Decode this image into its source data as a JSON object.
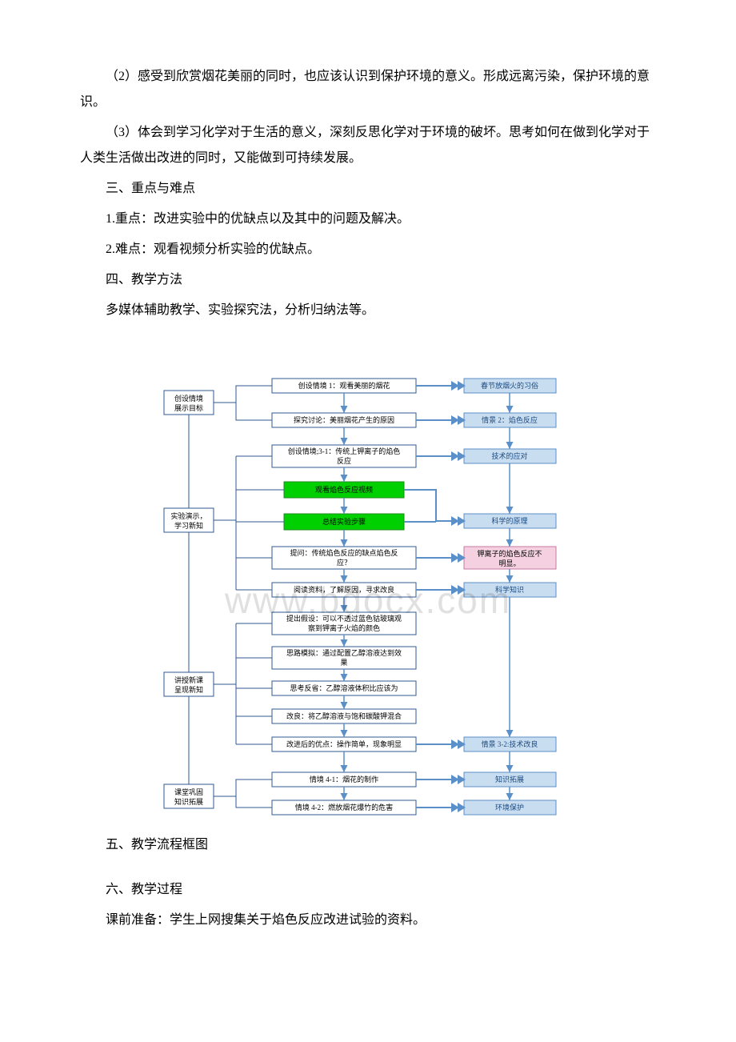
{
  "paragraphs": {
    "p1": "（2）感受到欣赏烟花美丽的同时，也应该认识到保护环境的意义。形成远离污染，保护环境的意识。",
    "p2": "（3）体会到学习化学对于生活的意义，深刻反思化学对于环境的破坏。思考如何在做到化学对于人类生活做出改进的同时，又能做到可持续发展。",
    "h3": "三、重点与难点",
    "p3": "1.重点：改进实验中的优缺点以及其中的问题及解决。",
    "p4": "2.难点：观看视频分析实验的优缺点。",
    "h4": "四、教学方法",
    "p5": "多媒体辅助教学、实验探究法，分析归纳法等。",
    "h5": "五、教学流程框图",
    "h6": "六、教学过程",
    "p6": "课前准备：学生上网搜集关于焰色反应改进试验的资料。"
  },
  "flow": {
    "left": {
      "l1a": "创设情境",
      "l1b": "展示目标",
      "l2a": "实验演示，",
      "l2b": "学习新知",
      "l3a": "讲授新课",
      "l3b": "呈现新知",
      "l4a": "课堂巩固",
      "l4b": "知识拓展"
    },
    "mid": {
      "m1": "创设情境 1：观看美丽的烟花",
      "m2": "探究讨论：美丽烟花产生的原因",
      "m3a": "创设情境;3-1：传统上钾离子的焰色",
      "m3b": "反应",
      "m4": "观看焰色反应视频",
      "m5": "总结实验步骤",
      "m6a": "提问：传统焰色反应的缺点焰色反",
      "m6b": "应？",
      "m7": "阅读资料，了解原因，寻求改良",
      "m8a": "提出假设：可以不透过蓝色钴玻璃观",
      "m8b": "察到钾离子火焰的颜色",
      "m9a": "思路模拟：通过配置乙醇溶液达到效",
      "m9b": "果",
      "m10": "思考反省：乙醇溶液体积比应该为",
      "m11": "改良：将乙醇溶液与饱和碳酸钾混合",
      "m12": "改进后的优点：操作简单，现象明显",
      "m13": "情境 4-1：烟花的制作",
      "m14": "情境 4-2：燃放烟花爆竹的危害"
    },
    "right": {
      "r1": "春节放烟火的习俗",
      "r2": "情景 2：焰色反应",
      "r3": "技术的应对",
      "r4": "科学的原理",
      "r5a": "钾离子的焰色反应不",
      "r5b": "明显。",
      "r6": "科学知识",
      "r7": "情景 3-2:技术改良",
      "r8": "知识拓展",
      "r9": "环境保护"
    }
  },
  "watermark": "www.bdocx.com"
}
